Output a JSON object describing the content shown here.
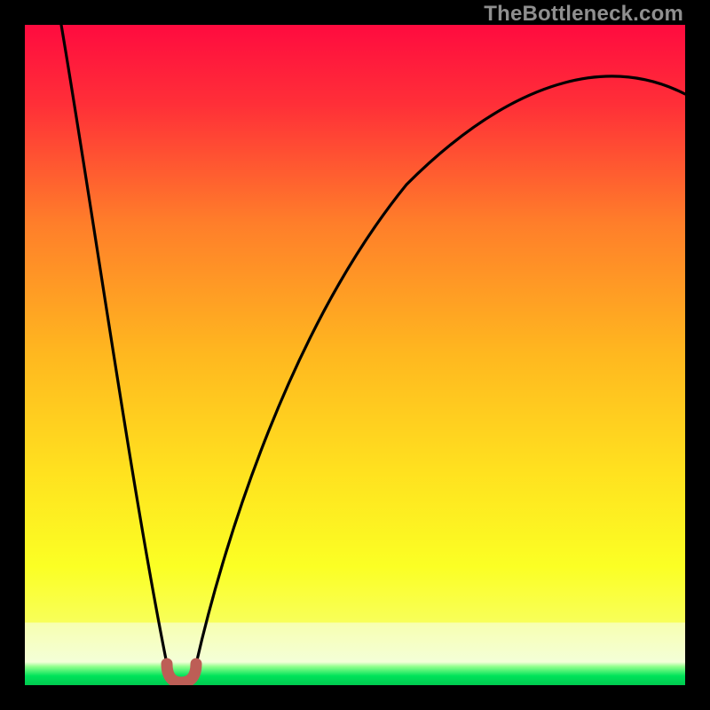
{
  "watermark": "TheBottleneck.com",
  "colors": {
    "frame": "#000000",
    "gradient_top": "#ff0b3f",
    "gradient_mid1": "#ff7e2a",
    "gradient_mid2": "#ffd21f",
    "gradient_mid3": "#faff24",
    "gradient_bottom_band": "#f7ffb0",
    "gradient_green": "#00e35a",
    "curve": "#000000",
    "marker": "#bd5e56"
  },
  "chart_data": {
    "type": "line",
    "title": "",
    "xlabel": "",
    "ylabel": "",
    "xlim": [
      0,
      1
    ],
    "ylim": [
      0,
      1
    ],
    "annotations": [],
    "series": [
      {
        "name": "bottleneck-curve-left",
        "x": [
          0.055,
          0.075,
          0.095,
          0.115,
          0.135,
          0.155,
          0.175,
          0.195,
          0.21,
          0.219
        ],
        "y": [
          1.0,
          0.87,
          0.74,
          0.61,
          0.48,
          0.35,
          0.225,
          0.11,
          0.045,
          0.017
        ]
      },
      {
        "name": "bottleneck-curve-right",
        "x": [
          0.255,
          0.29,
          0.33,
          0.38,
          0.44,
          0.51,
          0.59,
          0.68,
          0.78,
          0.89,
          1.0
        ],
        "y": [
          0.017,
          0.115,
          0.225,
          0.345,
          0.46,
          0.565,
          0.66,
          0.74,
          0.805,
          0.857,
          0.895
        ]
      },
      {
        "name": "optimal-marker",
        "x": [
          0.219,
          0.228,
          0.237,
          0.246,
          0.255
        ],
        "y": [
          0.017,
          0.007,
          0.006,
          0.007,
          0.017
        ]
      }
    ],
    "optimum_x": 0.237
  }
}
